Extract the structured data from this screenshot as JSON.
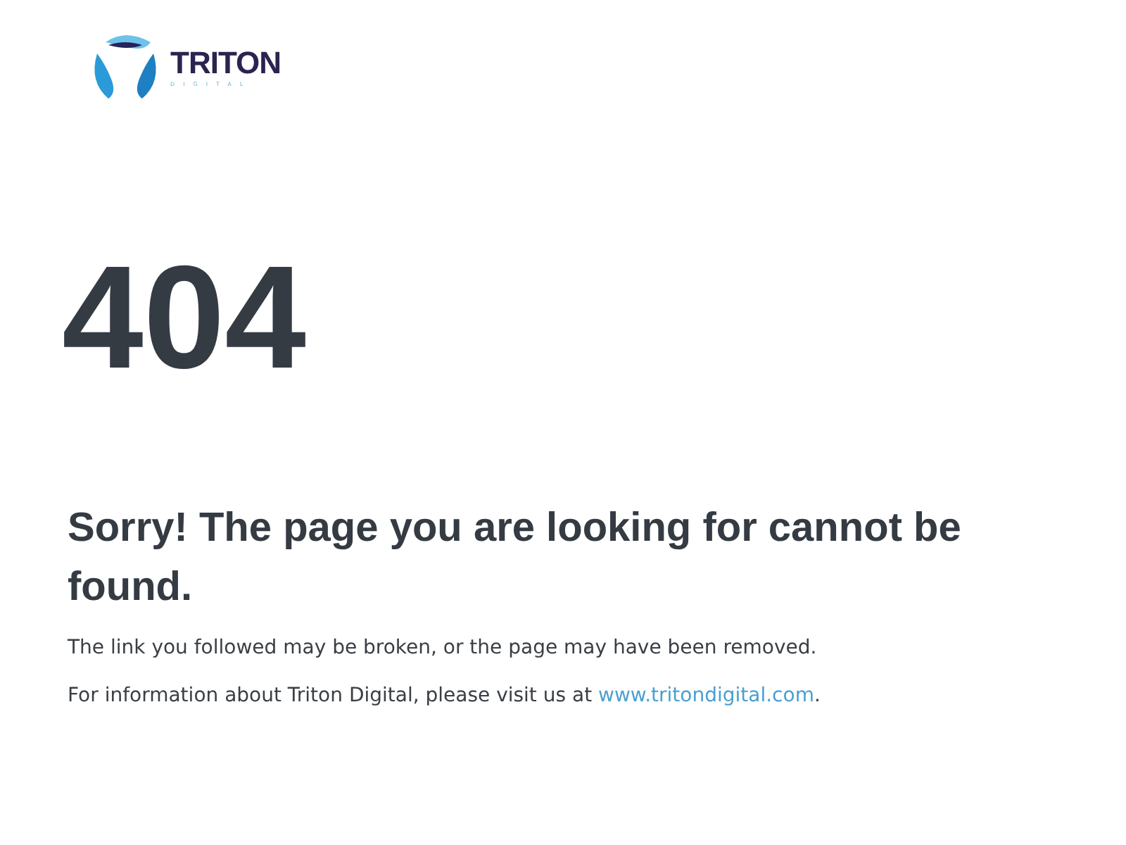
{
  "logo": {
    "name": "TRITON",
    "tagline": "DIGITAL"
  },
  "error_code": "404",
  "heading": "Sorry! The page you are looking for cannot be found.",
  "message": "The link you followed may be broken, or the page may have been removed.",
  "info": {
    "text": "For information about Triton Digital, please visit us at ",
    "link": "www.tritondigital.com",
    "after": "."
  }
}
